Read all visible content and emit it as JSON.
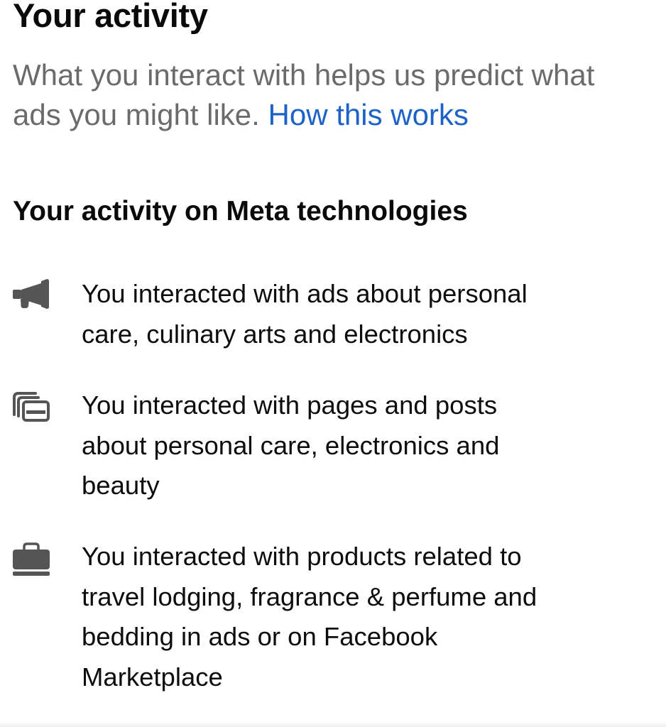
{
  "header": {
    "title": "Your activity",
    "description_line1": "What you interact with helps us predict what",
    "description_line2": "ads you might like. ",
    "link_label": "How this works"
  },
  "section": {
    "title": "Your activity on Meta technologies"
  },
  "activity_items": [
    {
      "icon": "megaphone-icon",
      "lines": [
        "You interacted with ads about personal",
        "care, culinary arts and electronics"
      ]
    },
    {
      "icon": "pages-stack-icon",
      "lines": [
        "You interacted with pages and posts",
        "about personal care, electronics and",
        "beauty"
      ]
    },
    {
      "icon": "shopping-bag-icon",
      "lines": [
        "You interacted with products related to",
        "travel lodging, fragrance & perfume and",
        "bedding in ads or on Facebook",
        "Marketplace"
      ]
    }
  ],
  "colors": {
    "text": "#0a0a0a",
    "secondary_text": "#6b6b6b",
    "link": "#1c62c9",
    "icon": "#555555"
  }
}
